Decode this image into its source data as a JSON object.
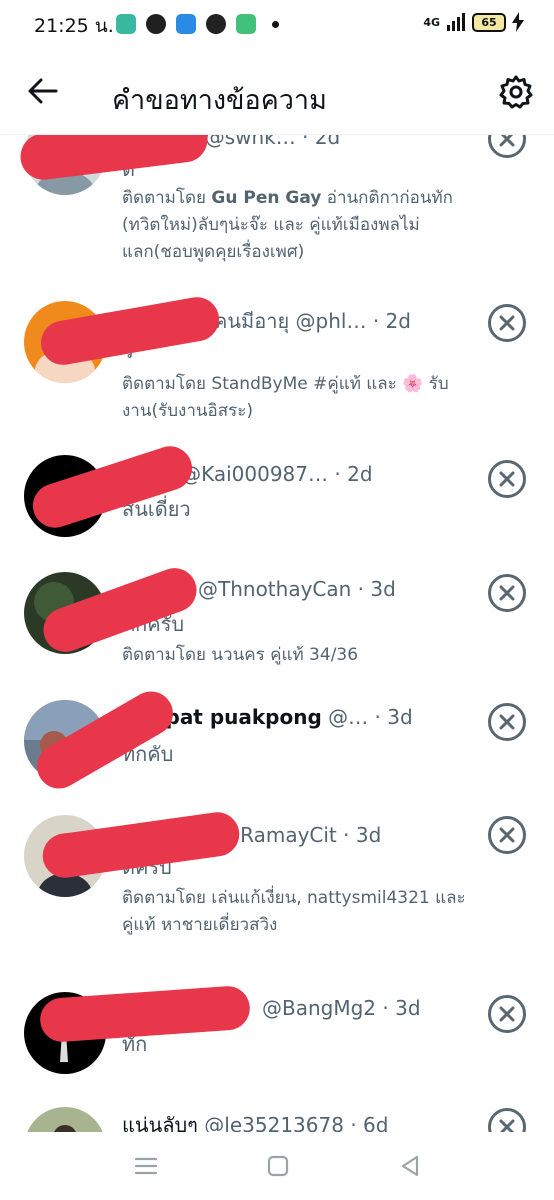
{
  "status_bar": {
    "time": "21:25 น.",
    "network": "4G",
    "battery": "65",
    "app_colors": [
      "#3ab7a0",
      "#1f1f1f",
      "#2b8ae6",
      "#222222",
      "#43c07a"
    ]
  },
  "header": {
    "title": "คำขอทางข้อความ"
  },
  "colors": {
    "text_primary": "#0f1419",
    "text_secondary": "#536471",
    "redaction": "#e8374b",
    "dismiss_icon": "#5b6770"
  },
  "requests": [
    {
      "name": "",
      "handle_line": "977951 @swnk…",
      "time": "· 2d",
      "message": "ด",
      "context_prefix": "ติดตามโดย ",
      "context_bold": "Gu Pen Gay",
      "context_rest": " อ่านกติกาก่อนทัก (ทวิตใหม่)ลับๆน่ะจ๊ะ และ คู่แท้เมืองพลไม่แลก(ชอบพูดคุยเรื่องเพศ)"
    },
    {
      "name": "",
      "handle_line": "คนมีอายุ @phl…",
      "time": "· 2d",
      "message": "ว",
      "context_prefix": "ติดตามโดย ",
      "context_bold": "",
      "context_rest": "StandByMe #คู่แท้ และ 🌸 รับงาน(รับงานอิสระ)"
    },
    {
      "name": "",
      "handle_line": "_£ @Kai000987…",
      "time": "· 2d",
      "message": "สนเดี่ยว",
      "context_prefix": "",
      "context_bold": "",
      "context_rest": ""
    },
    {
      "name": "",
      "handle_line": "@ThnothayCan",
      "time": "· 3d",
      "message": "ทักครับ",
      "context_prefix": "ติดตามโดย ",
      "context_bold": "",
      "context_rest": "นวนคร คู่แท้ 34/36"
    },
    {
      "name": "apat puakpong",
      "handle_line": " @…",
      "time": "· 3d",
      "message": "ทักคับ",
      "context_prefix": "",
      "context_bold": "",
      "context_rest": ""
    },
    {
      "name": "",
      "handle_line": "ง @RamayCit",
      "time": "· 3d",
      "message": "ดีครับ",
      "context_prefix": "ติดตามโดย ",
      "context_bold": "",
      "context_rest": "เล่นแก้เงี่ยน, nattysmil4321 และ คู่แท้ หาชายเดี่ยวสวิง"
    },
    {
      "name": "",
      "handle_line": "@BangMg2",
      "time": "· 3d",
      "message": "ทัก",
      "context_prefix": "",
      "context_bold": "",
      "context_rest": ""
    },
    {
      "name": "แน่นลับๆ",
      "handle_line": " @le35213678",
      "time": "· 6d",
      "message": "",
      "context_prefix": "",
      "context_bold": "",
      "context_rest": ""
    }
  ],
  "navbar": {
    "icons": [
      "menu-icon",
      "home-square-icon",
      "back-triangle-icon"
    ]
  }
}
